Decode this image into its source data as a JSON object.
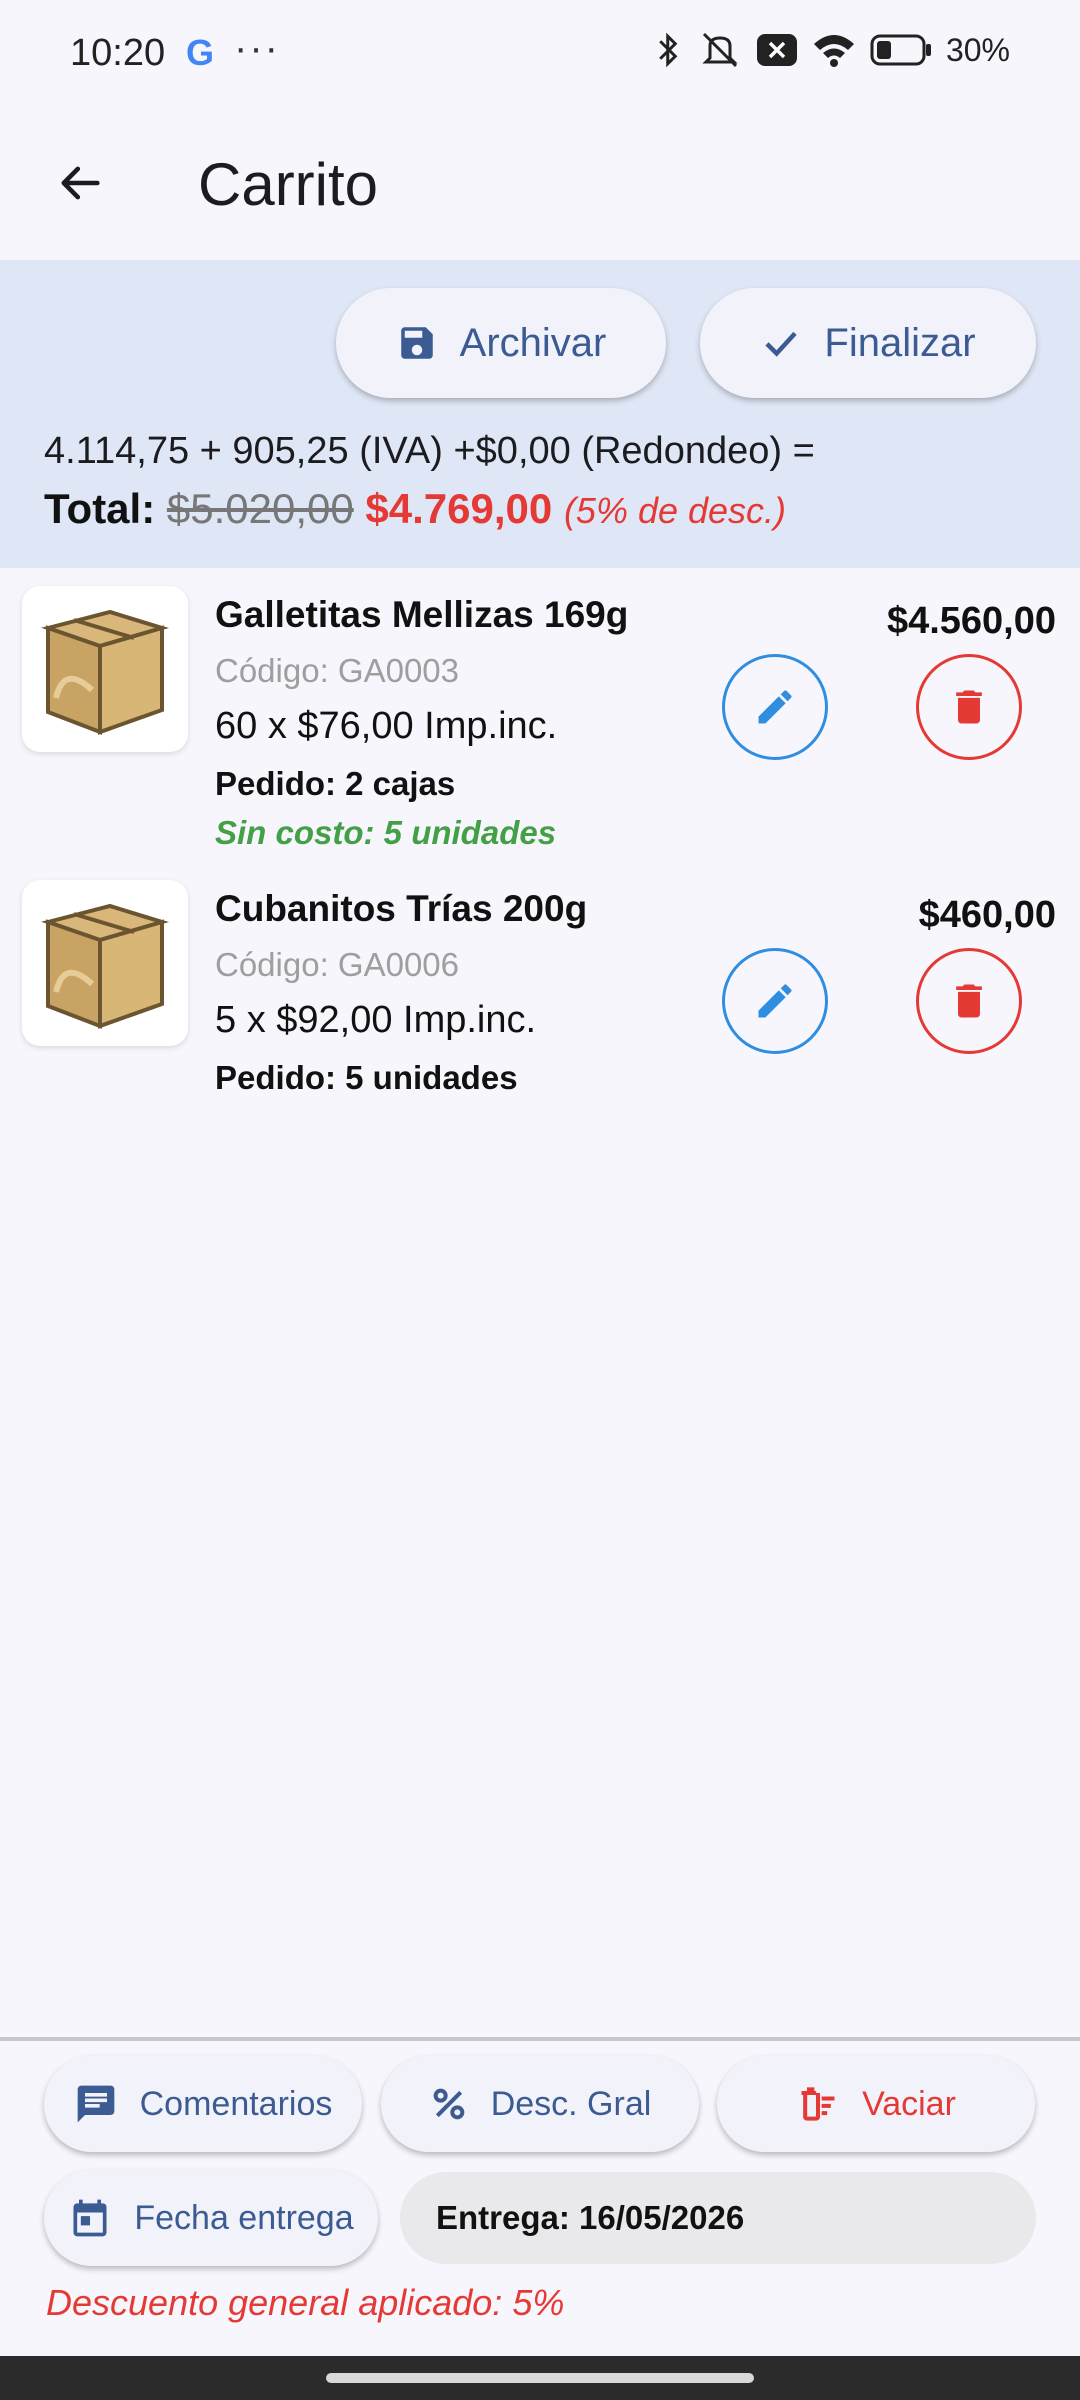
{
  "status_bar": {
    "time": "10:20",
    "google_letter": "G",
    "more_dots": "···",
    "battery_text": "30%",
    "icons": [
      "bluetooth-icon",
      "vibrate-off-icon",
      "notification-x-icon",
      "wifi-icon",
      "battery-icon"
    ]
  },
  "appbar": {
    "title": "Carrito",
    "back_icon": "arrow-back-icon"
  },
  "summary": {
    "archive_label": "Archivar",
    "finalize_label": "Finalizar",
    "breakdown": "4.114,75 + 905,25 (IVA) +$0,00 (Redondeo) =",
    "total_label": "Total:",
    "old_total": "$5.020,00",
    "new_total": "$4.769,00",
    "discount_note": "(5% de desc.)"
  },
  "items": [
    {
      "name": "Galletitas Mellizas 169g",
      "code": "Código: GA0003",
      "qty_line": "60 x $76,00  Imp.inc.",
      "order": "Pedido: 2 cajas",
      "free": "Sin costo: 5 unidades",
      "price": "$4.560,00"
    },
    {
      "name": "Cubanitos Trías 200g",
      "code": "Código: GA0006",
      "qty_line": "5 x $92,00  Imp.inc.",
      "order": "Pedido: 5 unidades",
      "price": "$460,00"
    }
  ],
  "bottom": {
    "comments_label": "Comentarios",
    "discount_label": "Desc. Gral",
    "empty_label": "Vaciar",
    "date_label": "Fecha entrega",
    "delivery_text": "Entrega: 16/05/2026",
    "general_discount": "Descuento general aplicado: 5%"
  },
  "colors": {
    "accent_blue": "#3b5b92",
    "edit_blue": "#2f8ee0",
    "danger_red": "#e53935",
    "free_green": "#43a047",
    "summary_bg": "#dfe7f7"
  }
}
